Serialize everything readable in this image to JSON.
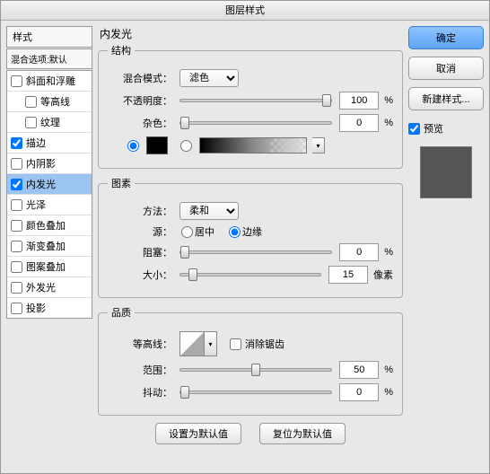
{
  "title": "图层样式",
  "left": {
    "styleHeader": "样式",
    "blendHeader": "混合选项:默认",
    "items": [
      {
        "label": "斜面和浮雕",
        "checked": false,
        "indent": false
      },
      {
        "label": "等高线",
        "checked": false,
        "indent": true
      },
      {
        "label": "纹理",
        "checked": false,
        "indent": true
      },
      {
        "label": "描边",
        "checked": true,
        "indent": false
      },
      {
        "label": "内阴影",
        "checked": false,
        "indent": false
      },
      {
        "label": "内发光",
        "checked": true,
        "indent": false,
        "selected": true
      },
      {
        "label": "光泽",
        "checked": false,
        "indent": false
      },
      {
        "label": "颜色叠加",
        "checked": false,
        "indent": false
      },
      {
        "label": "渐变叠加",
        "checked": false,
        "indent": false
      },
      {
        "label": "图案叠加",
        "checked": false,
        "indent": false
      },
      {
        "label": "外发光",
        "checked": false,
        "indent": false
      },
      {
        "label": "投影",
        "checked": false,
        "indent": false
      }
    ]
  },
  "center": {
    "title": "内发光",
    "structure": {
      "legend": "结构",
      "blendModeLabel": "混合模式：",
      "blendModeValue": "滤色",
      "opacityLabel": "不透明度：",
      "opacityValue": "100",
      "opacityUnit": "%",
      "noiseLabel": "杂色：",
      "noiseValue": "0",
      "noiseUnit": "%"
    },
    "elements": {
      "legend": "图素",
      "techniqueLabel": "方法：",
      "techniqueValue": "柔和",
      "sourceLabel": "源：",
      "sourceCenter": "居中",
      "sourceEdge": "边缘",
      "chokeLabel": "阻塞：",
      "chokeValue": "0",
      "chokeUnit": "%",
      "sizeLabel": "大小：",
      "sizeValue": "15",
      "sizeUnit": "像素"
    },
    "quality": {
      "legend": "品质",
      "contourLabel": "等高线：",
      "antiAlias": "消除锯齿",
      "rangeLabel": "范围：",
      "rangeValue": "50",
      "rangeUnit": "%",
      "jitterLabel": "抖动：",
      "jitterValue": "0",
      "jitterUnit": "%"
    },
    "buttons": {
      "setDefault": "设置为默认值",
      "resetDefault": "复位为默认值"
    }
  },
  "right": {
    "ok": "确定",
    "cancel": "取消",
    "newStyle": "新建样式...",
    "preview": "预览"
  }
}
